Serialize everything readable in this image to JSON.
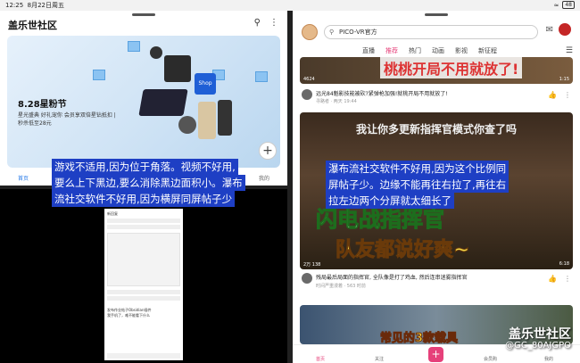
{
  "status": {
    "time": "12:25",
    "date": "8月22日周五",
    "battery": "48"
  },
  "left_top": {
    "app_title": "盖乐世社区",
    "banner_title": "8.28星粉节",
    "banner_sub": "星光盛典 好礼宠你 会员享双倍星钻抵扣 | 秒杀低至28元",
    "tab_home": "首页",
    "tab_me": "我的"
  },
  "right": {
    "search_text": "PICO-VR官方",
    "tabs": [
      "直播",
      "推荐",
      "热门",
      "动画",
      "影视",
      "新征程"
    ],
    "video1_caption": "桃桃开局不用就放了!",
    "video1_views": "4624",
    "video1_duration": "1:15",
    "video1_title": "远光84魁影技能被砍?紧弹枪加强!就桃开局不用就放了!",
    "video1_meta": "寻路者 · 两天 19:44",
    "video2_question": "我让你多更新指挥官模式你查了吗",
    "video2_big1": "闪电战指挥官",
    "video2_big2": "队友都说好爽~",
    "video2_stats": "2万  138",
    "video2_duration": "6:18",
    "video2_title": "残局最后局面的指挥官, 全队像是打了鸡血, 然后连串迷雾指挥官",
    "video2_meta": "时间严重漫着 · 563 时前",
    "video3_caption": "常见的3款载具",
    "bottom_tabs": [
      "首页",
      "关注",
      "会员购",
      "我的"
    ]
  },
  "subtitles": {
    "left": [
      "游戏不适用,因为位于角落。视频不好用,",
      "要么上下黑边,要么消除黑边面积小。瀑布",
      "流社交软件不好用,因为横屏同屏帖子少"
    ],
    "right": [
      "瀑布流社交软件不好用,因为这个比例同",
      "屏帖子少。边缘不能再往右拉了,再往右",
      "拉左边两个分屏就太细长了"
    ]
  },
  "phone": {
    "header": "新回复",
    "post_title": "发布作业帖子Obsidian插件",
    "note": "我手机了，难不能看下什么"
  },
  "watermark": {
    "line1": "盖乐世社区",
    "line2": "@GC_80AJGPO"
  },
  "colors": {
    "accent_pink": "#e6407a",
    "subtitle_bg": "#1e3fc4",
    "blue": "#2b7de9"
  }
}
